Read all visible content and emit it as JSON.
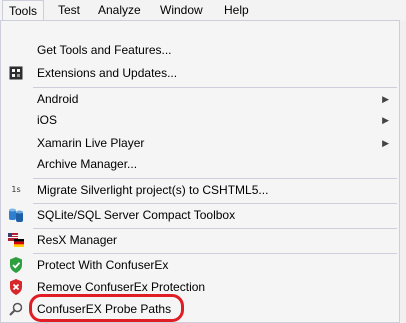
{
  "menubar": {
    "items": [
      "Tools",
      "Test",
      "Analyze",
      "Window",
      "Help"
    ]
  },
  "menu": {
    "items": [
      {
        "label": "Get Tools and Features...",
        "icon": "none"
      },
      {
        "label": "Extensions and Updates...",
        "icon": "extensions-icon"
      },
      {
        "label": "Android",
        "icon": "none",
        "submenu": true
      },
      {
        "label": "iOS",
        "icon": "none",
        "submenu": true
      },
      {
        "label": "Xamarin Live Player",
        "icon": "none",
        "submenu": true
      },
      {
        "label": "Archive Manager...",
        "icon": "none"
      },
      {
        "label": "Migrate Silverlight project(s) to CSHTML5...",
        "icon": "migrate-icon"
      },
      {
        "label": "SQLite/SQL Server Compact Toolbox",
        "icon": "database-icon"
      },
      {
        "label": "ResX Manager",
        "icon": "flags-icon"
      },
      {
        "label": "Protect With ConfuserEx",
        "icon": "shield-check-icon"
      },
      {
        "label": "Remove ConfuserEx Protection",
        "icon": "shield-x-icon"
      },
      {
        "label": "ConfuserEX Probe Paths",
        "icon": "magnifier-icon"
      }
    ],
    "migrate_glyph": "1s"
  },
  "colors": {
    "highlight": "#e01c24",
    "shield_green": "#2e9e3e",
    "shield_red": "#d9262b",
    "db_blue": "#2f7fd1"
  }
}
